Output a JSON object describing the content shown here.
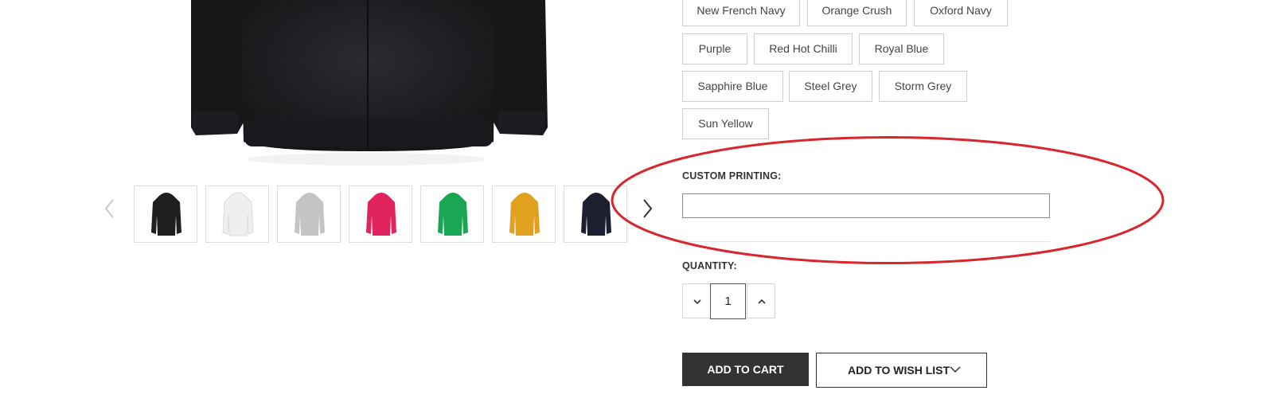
{
  "swatches": [
    "New French Navy",
    "Orange Crush",
    "Oxford Navy",
    "Purple",
    "Red Hot Chilli",
    "Royal Blue",
    "Sapphire Blue",
    "Steel Grey",
    "Storm Grey",
    "Sun Yellow"
  ],
  "thumbnails": [
    {
      "name": "thumb-black",
      "color": "#1f1f22"
    },
    {
      "name": "thumb-white",
      "color": "#efefef"
    },
    {
      "name": "thumb-grey",
      "color": "#c4c4c6"
    },
    {
      "name": "thumb-pink",
      "color": "#e0245e"
    },
    {
      "name": "thumb-green",
      "color": "#1aa653"
    },
    {
      "name": "thumb-gold",
      "color": "#e0a020"
    },
    {
      "name": "thumb-navy",
      "color": "#1c1f30"
    }
  ],
  "icons": {
    "prev": "chevron-left-icon",
    "next": "chevron-right-icon",
    "decrease": "chevron-down-icon",
    "increase": "chevron-up-icon",
    "wishlist_dropdown": "chevron-down-icon"
  },
  "custom_printing": {
    "label": "CUSTOM PRINTING:",
    "value": ""
  },
  "quantity": {
    "label": "QUANTITY:",
    "value": "1"
  },
  "actions": {
    "add_to_cart": "ADD TO CART",
    "add_to_wish_list": "ADD TO WISH LIST"
  },
  "colors": {
    "highlight": "#d9262c",
    "primary_button": "#333333"
  }
}
